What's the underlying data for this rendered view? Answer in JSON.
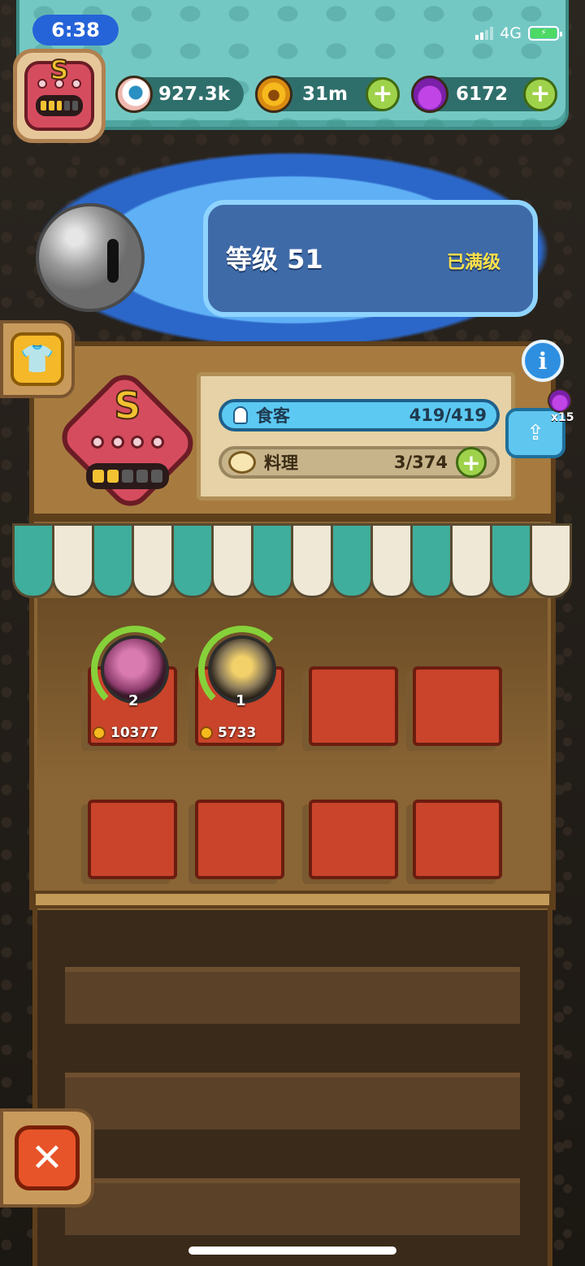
{
  "status_bar": {
    "time": "6:38",
    "network": "4G",
    "battery_icon": "battery-charging-icon"
  },
  "resources": [
    {
      "icon": "eyeball-icon",
      "value": "927.3k",
      "has_plus": false
    },
    {
      "icon": "coin-icon",
      "value": "31m",
      "has_plus": true
    },
    {
      "icon": "potion-icon",
      "value": "6172",
      "has_plus": true
    }
  ],
  "profile": {
    "rank_letter": "S",
    "rank_progress": {
      "filled": 3,
      "total": 5
    }
  },
  "level": {
    "title": "等级 51",
    "status": "已满级"
  },
  "shop": {
    "rank_letter": "S",
    "rank_progress": {
      "filled": 2,
      "total": 5
    },
    "diners_label": "食客",
    "diners_value": "419/419",
    "dishes_label": "料理",
    "dishes_value": "3/374",
    "share_count": "x15"
  },
  "slots_row1": [
    {
      "dish": "purple-dish",
      "qty": "2",
      "price": "10377"
    },
    {
      "dish": "gold-dish",
      "qty": "1",
      "price": "5733"
    },
    {
      "dish": null
    },
    {
      "dish": null
    }
  ],
  "slots_row2": [
    {
      "dish": null
    },
    {
      "dish": null
    },
    {
      "dish": null
    },
    {
      "dish": null
    }
  ],
  "colors": {
    "hud": "#74c8c4",
    "level_panel": "#3f6aa8",
    "level_max": "#ffe14a",
    "diners_bar": "#5cc9f2",
    "plus_green": "#9fd24b",
    "mat_red": "#c9442a",
    "close_orange": "#e8542a"
  }
}
